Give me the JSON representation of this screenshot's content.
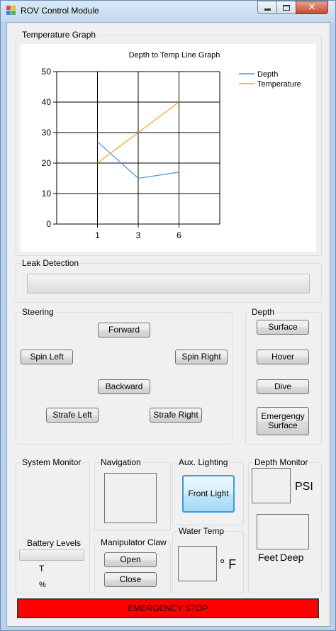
{
  "window": {
    "title": "ROV Control Module",
    "caption_buttons": {
      "minimize": "minimize-icon",
      "maximize": "maximize-icon",
      "close": "close-icon"
    }
  },
  "temperature_graph": {
    "group_label": "Temperature Graph"
  },
  "chart_data": {
    "type": "line",
    "title": "Depth to Temp Line Graph",
    "categories": [
      "1",
      "3",
      "6"
    ],
    "series": [
      {
        "name": "Depth",
        "values": [
          27,
          15,
          17
        ],
        "color": "#4a90e2"
      },
      {
        "name": "Temperature",
        "values": [
          20,
          30,
          40
        ],
        "color": "#f5a623"
      }
    ],
    "ylim": [
      0,
      50
    ],
    "yticks": [
      "0",
      "10",
      "20",
      "30",
      "40",
      "50"
    ],
    "grid": true,
    "legend": "top-right"
  },
  "leak_detection": {
    "group_label": "Leak Detection"
  },
  "steering": {
    "group_label": "Steering",
    "forward": "Forward",
    "spin_left": "Spin Left",
    "spin_right": "Spin Right",
    "backward": "Backward",
    "strafe_left": "Strafe Left",
    "strafe_right": "Strafe Right"
  },
  "depth": {
    "group_label": "Depth",
    "surface": "Surface",
    "hover": "Hover",
    "dive": "Dive",
    "emergency_surface_line1": "Emergengy",
    "emergency_surface_line2": "Surface"
  },
  "system_monitor": {
    "group_label": "System Monitor",
    "battery_label": "Battery Levels",
    "t_label": "T",
    "percent_label": "%"
  },
  "navigation": {
    "group_label": "Navigation"
  },
  "manipulator_claw": {
    "group_label": "Manipulator Claw",
    "open": "Open",
    "close": "Close"
  },
  "aux_lighting": {
    "group_label": "Aux. Lighting",
    "front_light": "Front Light"
  },
  "water_temp": {
    "group_label": "Water Temp",
    "unit": "° F"
  },
  "depth_monitor": {
    "group_label": "Depth Monitor",
    "psi": "PSI",
    "feet": "Feet",
    "deep": "Deep"
  },
  "emergency_stop": {
    "label": "EMERGENCY STOP",
    "color": "#ff0000"
  }
}
